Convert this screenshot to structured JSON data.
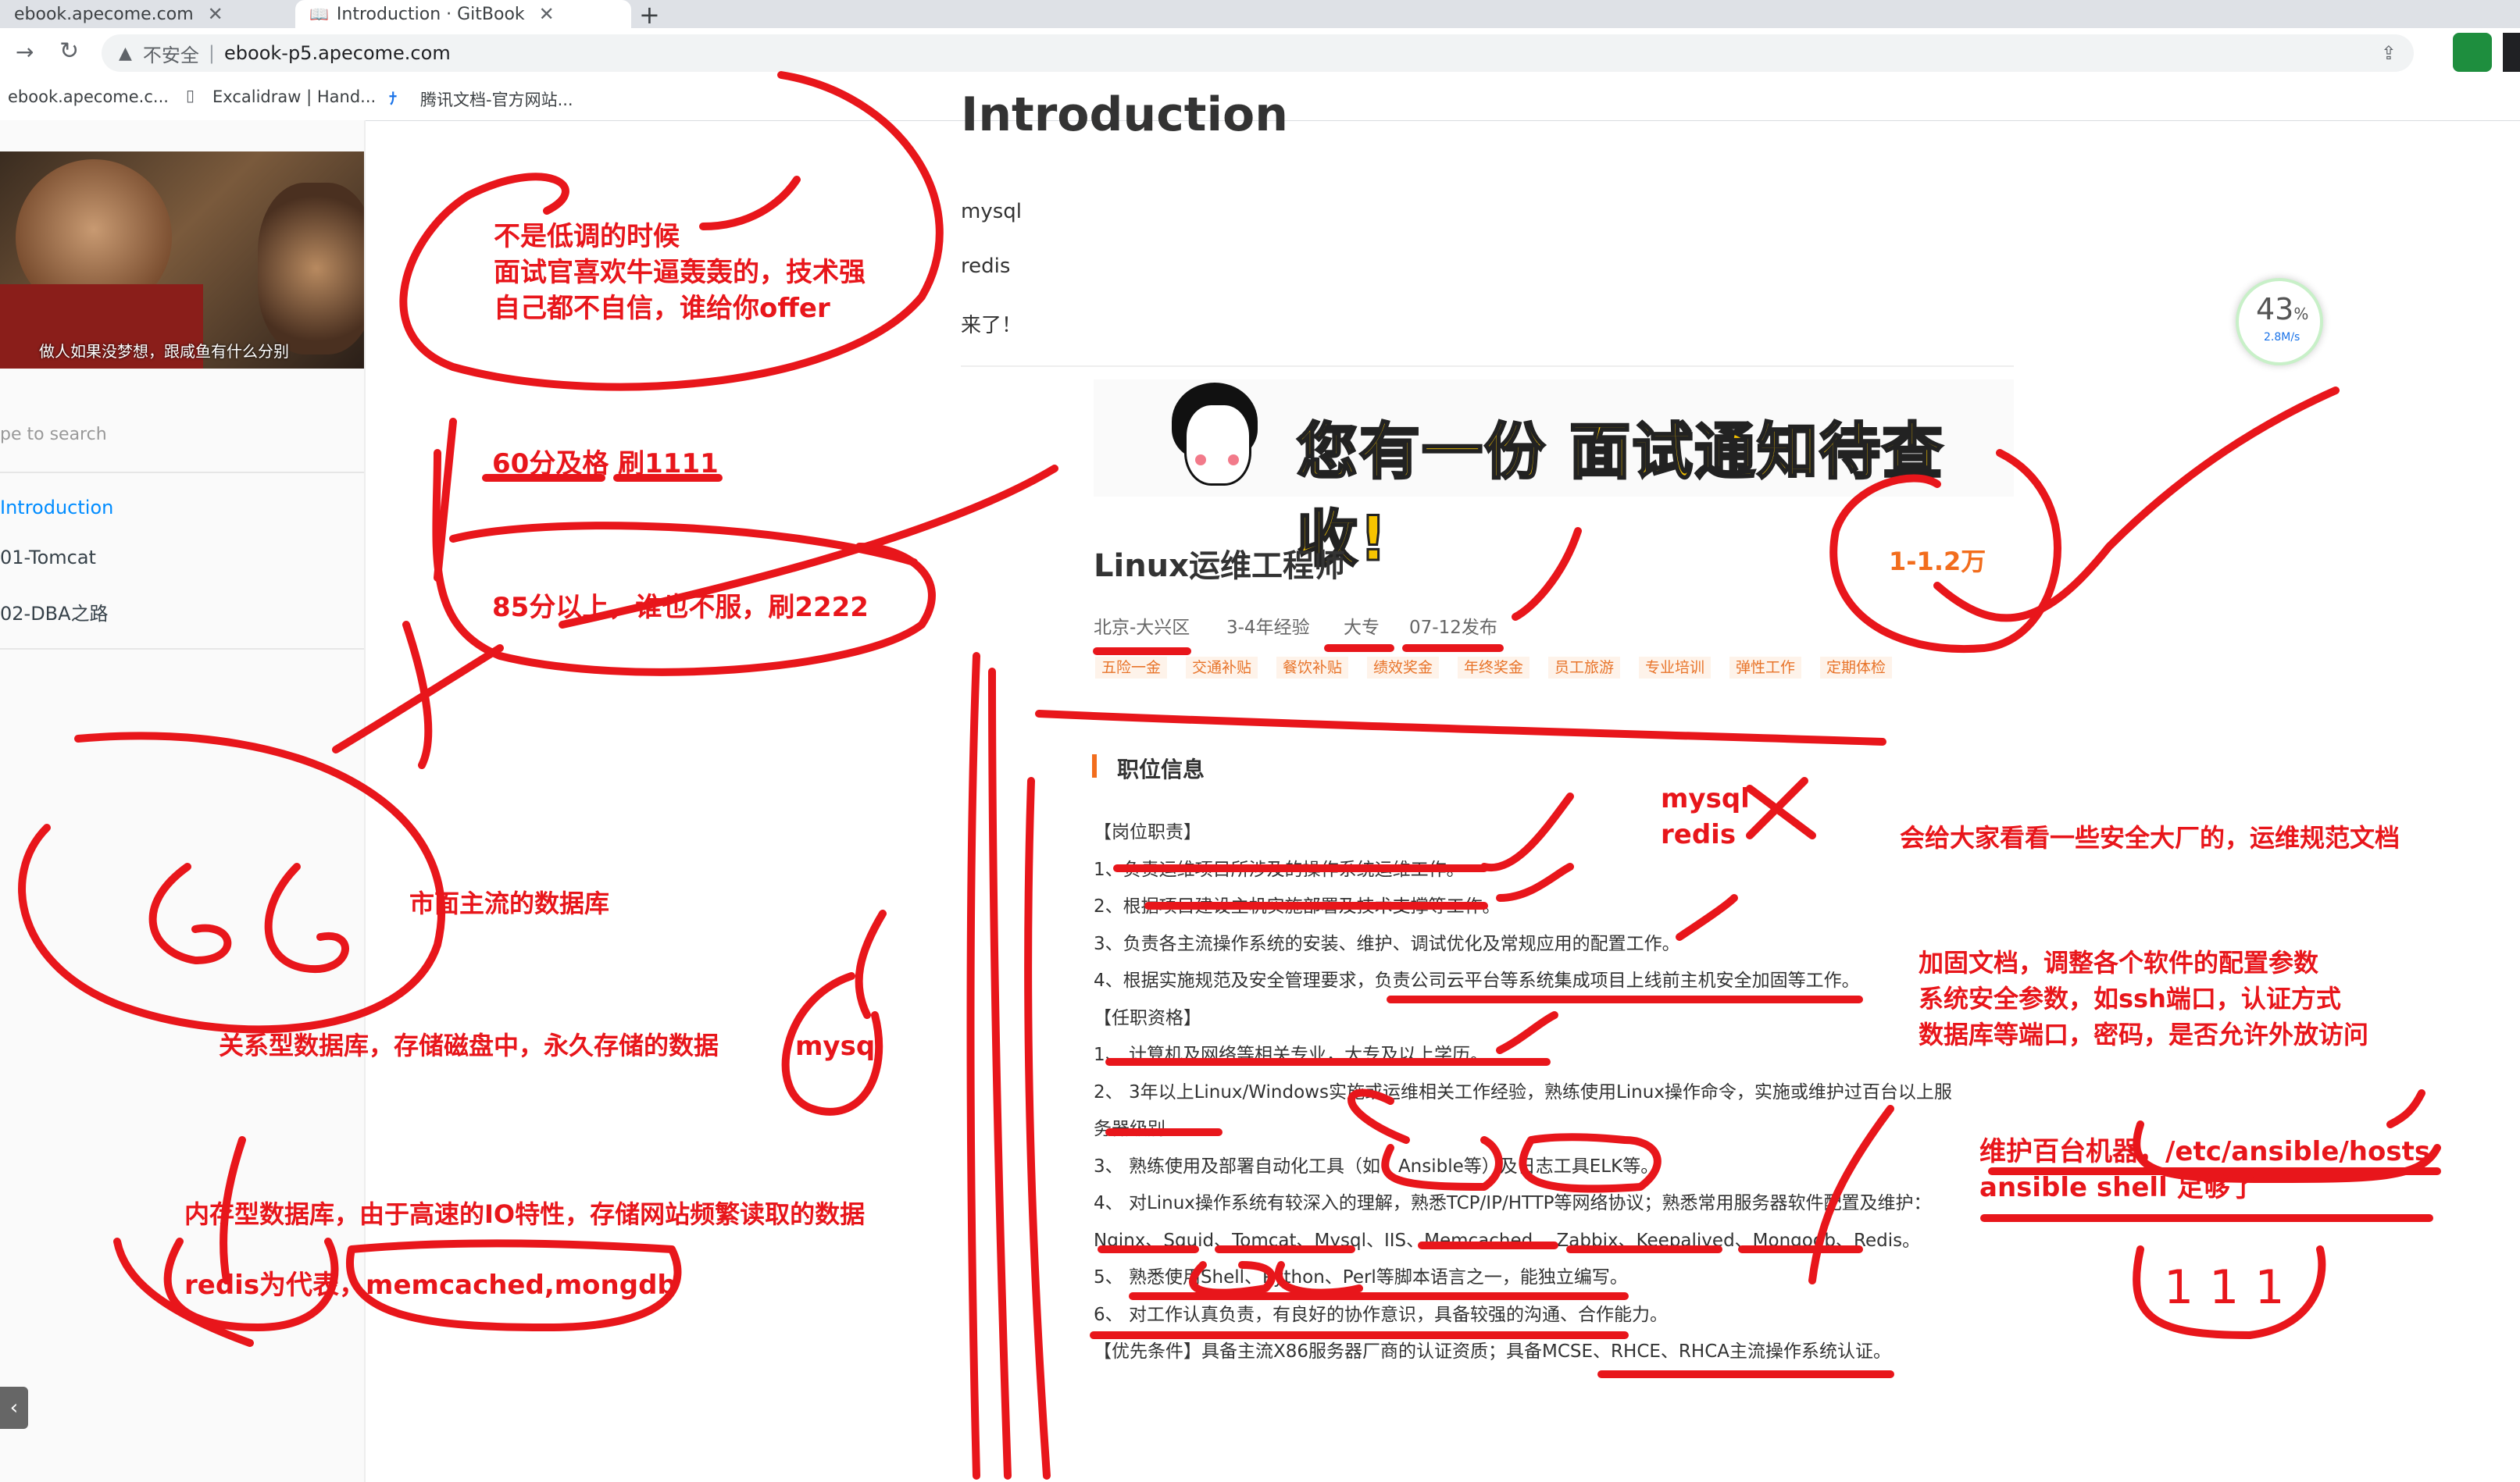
{
  "browser": {
    "tabs": [
      {
        "title": "ebook.apecome.com"
      },
      {
        "title": "Introduction · GitBook"
      }
    ],
    "new_tab": "+",
    "security_label": "不安全",
    "url": "ebook-p5.apecome.com",
    "bookmarks": [
      "ebook.apecome.c...",
      "Excalidraw | Hand...",
      "腾讯文档-官方网站..."
    ]
  },
  "sidebar": {
    "video_caption": "做人如果没梦想，跟咸鱼有什么分别",
    "search_placeholder": "pe to search",
    "items": [
      {
        "label": "Introduction",
        "active": true
      },
      {
        "label": "01-Tomcat",
        "active": false
      },
      {
        "label": "02-DBA之路",
        "active": false
      }
    ]
  },
  "page": {
    "heading": "Introduction",
    "lines": [
      "mysql",
      "redis",
      "来了！"
    ]
  },
  "network_widget": {
    "percent": "43",
    "unit": "%",
    "speed": "2.8M/s"
  },
  "job": {
    "banner_text": "您有一份 面试通知待查收!",
    "title": "Linux运维工程师",
    "salary": "1-1.2万",
    "meta": [
      "北京-大兴区",
      "3-4年经验",
      "大专",
      "07-12发布"
    ],
    "tags": [
      "五险一金",
      "交通补贴",
      "餐饮补贴",
      "绩效奖金",
      "年终奖金",
      "员工旅游",
      "专业培训",
      "弹性工作",
      "定期体检"
    ],
    "section_title": "职位信息",
    "lines": [
      "【岗位职责】",
      "1、负责运维项目所涉及的操作系统运维工作。",
      "2、根据项目建设主机实施部署及技术支撑等工作。",
      "3、负责各主流操作系统的安装、维护、调试优化及常规应用的配置工作。",
      "4、根据实施规范及安全管理要求，负责公司云平台等系统集成项目上线前主机安全加固等工作。",
      "【任职资格】",
      "1、 计算机及网络等相关专业，大专及以上学历。",
      "2、 3年以上Linux/Windows实施或运维相关工作经验，熟练使用Linux操作命令，实施或维护过百台以上服",
      "务器级别。",
      "3、 熟练使用及部署自动化工具（如：Ansible等）及日志工具ELK等。",
      "4、 对Linux操作系统有较深入的理解，熟悉TCP/IP/HTTP等网络协议；熟悉常用服务器软件配置及维护：",
      "Nginx、Squid、Tomcat、Mysql、IIS、Memcached 、Zabbix、Keepalived、Mongodb、Redis。",
      "5、 熟悉使用Shell、Python、Perl等脚本语言之一，能独立编写。",
      "6、 对工作认真负责，有良好的协作意识，具备较强的沟通、合作能力。",
      "【优先条件】具备主流X86服务器厂商的认证资质；具备MCSE、RHCE、RHCA主流操作系统认证。"
    ]
  },
  "annotations": {
    "a1": [
      "不是低调的时候",
      "面试官喜欢牛逼轰轰的，技术强",
      "自己都不自信，谁给你offer"
    ],
    "a2": "60分及格  刷1111",
    "a3": "85分以上，谁也不服，刷2222",
    "a4": "66",
    "a5": "市面主流的数据库",
    "a6": "关系型数据库，存储磁盘中，永久存储的数据",
    "a7": "mysql",
    "a8": "内存型数据库，由于高速的IO特性，存储网站频繁读取的数据",
    "a9": "redis为代表，memcached,mongdb",
    "a10": [
      "mysql",
      "redis"
    ],
    "a11": "会给大家看看一些安全大厂的，运维规范文档",
    "a12": [
      "加固文档，调整各个软件的配置参数",
      "系统安全参数，如ssh端口，认证方式",
      "数据库等端口，密码，是否允许外放访问"
    ],
    "a13": [
      "维护百台机器，/etc/ansible/hosts",
      "ansible shell 足够了"
    ],
    "a14": "111",
    "ink_color": "#e8161b"
  },
  "colors": {
    "accent": "#008cff",
    "annotation": "#e8161b",
    "salary": "#f26d1d"
  }
}
